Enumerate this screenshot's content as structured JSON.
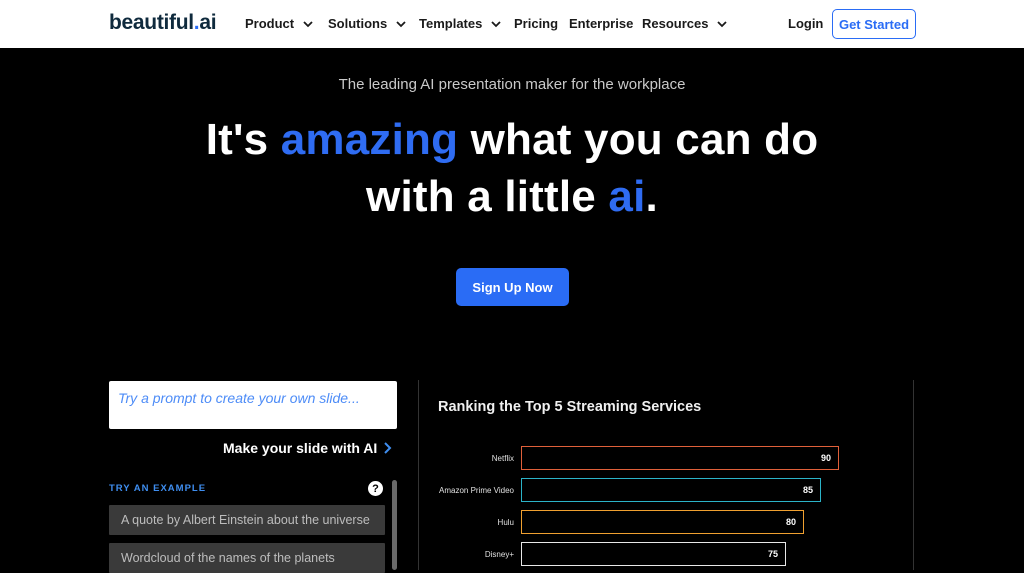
{
  "nav": {
    "logo_main": "beautiful",
    "logo_dot": ".",
    "logo_suffix": "ai",
    "items": [
      {
        "label": "Product",
        "has_dropdown": true
      },
      {
        "label": "Solutions",
        "has_dropdown": true
      },
      {
        "label": "Templates",
        "has_dropdown": true
      },
      {
        "label": "Pricing",
        "has_dropdown": false
      },
      {
        "label": "Enterprise",
        "has_dropdown": false
      },
      {
        "label": "Resources",
        "has_dropdown": true
      }
    ],
    "login": "Login",
    "get_started": "Get Started"
  },
  "hero": {
    "tagline": "The leading AI presentation maker for the workplace",
    "headline_1a": "It's ",
    "headline_1b": "amazing",
    "headline_1c": " what you can do",
    "headline_2a": "with a little ",
    "headline_2b": "ai",
    "headline_2c": ".",
    "cta": "Sign Up Now"
  },
  "prompt": {
    "placeholder": "Try a prompt to create your own slide...",
    "make_slide": "Make your slide with AI",
    "try_example": "TRY AN EXAMPLE",
    "help": "?",
    "examples": [
      "A quote by Albert Einstein about the universe",
      "Wordcloud of the names of the planets"
    ]
  },
  "chart_data": {
    "type": "bar",
    "title": "Ranking the Top 5 Streaming Services",
    "categories": [
      "Netflix",
      "Amazon Prime Video",
      "Hulu",
      "Disney+"
    ],
    "values": [
      90,
      85,
      80,
      75
    ],
    "colors": [
      "#e0603a",
      "#2bb3c8",
      "#f0a030",
      "#e8e8e8"
    ]
  },
  "colors": {
    "accent": "#2a6cf5",
    "background": "#000000"
  }
}
